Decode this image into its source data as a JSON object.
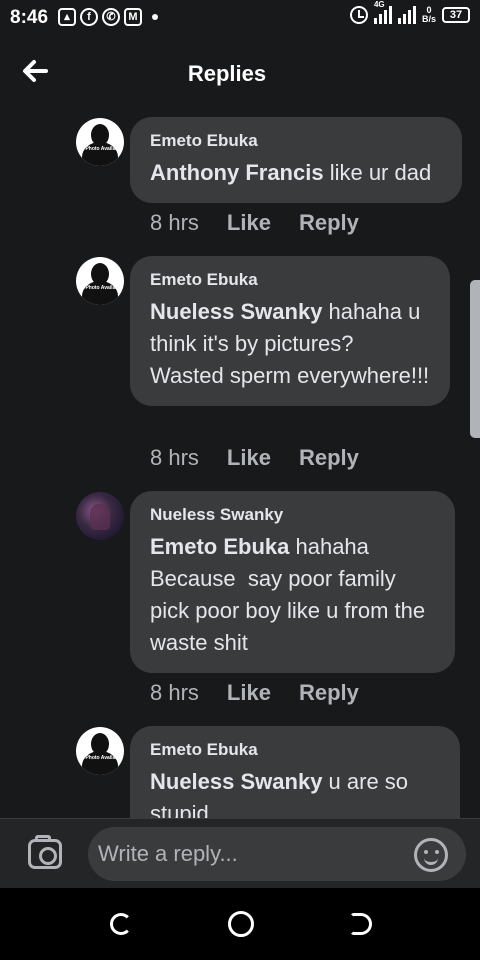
{
  "status_bar": {
    "time": "8:46",
    "notifications": [
      "gallery-icon",
      "facebook-icon",
      "whatsapp-icon",
      "gmail-icon"
    ],
    "network": "4G",
    "speed_value": "0",
    "speed_unit": "B/s",
    "battery": "37"
  },
  "header": {
    "title": "Replies"
  },
  "replies": [
    {
      "author": "Emeto Ebuka",
      "mention": "Anthony Francis",
      "text": " like ur dad",
      "time": "8 hrs",
      "like_label": "Like",
      "reply_label": "Reply",
      "avatar": "no-photo",
      "avatar_text": "No Photo Available"
    },
    {
      "author": "Emeto Ebuka",
      "mention": "Nueless Swanky",
      "text": " hahaha u think it's by pictures? Wasted sperm everywhere!!!",
      "time": "8 hrs",
      "like_label": "Like",
      "reply_label": "Reply",
      "avatar": "no-photo",
      "avatar_text": "No Photo Available"
    },
    {
      "author": "Nueless Swanky",
      "mention": "Emeto Ebuka",
      "text": " hahaha   Because  say poor family pick poor boy like u from the waste shit",
      "time": "8 hrs",
      "like_label": "Like",
      "reply_label": "Reply",
      "avatar": "photo"
    },
    {
      "author": "Emeto Ebuka",
      "mention": "Nueless Swanky",
      "text": " u are so stupid",
      "avatar": "no-photo",
      "avatar_text": "No Photo Available"
    }
  ],
  "composer": {
    "placeholder": "Write a reply..."
  },
  "colors": {
    "background": "#18191a",
    "bubble": "#3a3b3c",
    "secondary_text": "#b0b3b8"
  }
}
